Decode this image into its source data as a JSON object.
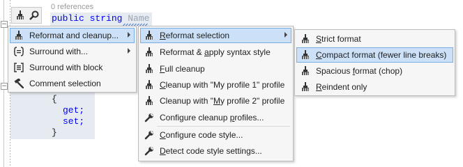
{
  "editor": {
    "references": "0 references",
    "keyword_public": "public",
    "keyword_string": "string",
    "property_name": "Name",
    "open_brace": "{",
    "get": "get;",
    "set": "set;",
    "close_brace": "}"
  },
  "action_button": {
    "icons": [
      "broom-icon",
      "search-icon"
    ]
  },
  "menu1": {
    "items": [
      {
        "label": "Reformat and cleanup...",
        "icon": "broom-icon",
        "submenu": true,
        "selected": true
      },
      {
        "label": "Surround with...",
        "icon": "surround-icon",
        "submenu": true
      },
      {
        "label": "Surround with block",
        "icon": "surround-block-icon",
        "submenu": false
      },
      {
        "label": "Comment selection",
        "icon": "hammer-icon",
        "submenu": false
      }
    ]
  },
  "menu2": {
    "items": [
      {
        "pre": "",
        "acc": "R",
        "post": "eformat selection",
        "icon": "broom-icon",
        "submenu": true,
        "selected": true
      },
      {
        "pre": "Reformat & ",
        "acc": "a",
        "post": "pply syntax style",
        "icon": "broom-icon"
      },
      {
        "pre": "",
        "acc": "F",
        "post": "ull cleanup",
        "icon": "broom-icon"
      },
      {
        "pre": "",
        "acc": "C",
        "post": "leanup with \"My profile 1\" profile",
        "icon": "broom-icon"
      },
      {
        "pre": "Cleanup with \"",
        "acc": "M",
        "post": "y profile 2\" profile",
        "icon": "broom-icon"
      },
      {
        "pre": "Configure cleanup ",
        "acc": "p",
        "post": "rofiles...",
        "icon": "wrench-icon"
      },
      {
        "pre": "",
        "acc": "C",
        "post": "onfigure code style...",
        "icon": "wrench-icon"
      },
      {
        "pre": "",
        "acc": "D",
        "post": "etect code style settings...",
        "icon": "wrench-icon"
      }
    ]
  },
  "menu3": {
    "items": [
      {
        "pre": "",
        "acc": "S",
        "post": "trict format",
        "icon": "broom-icon"
      },
      {
        "pre": "",
        "acc": "C",
        "post": "ompact format (fewer line breaks)",
        "icon": "broom-icon",
        "selected": true
      },
      {
        "pre": "Spacious ",
        "acc": "f",
        "post": "ormat (chop)",
        "icon": "broom-icon"
      },
      {
        "pre": "",
        "acc": "R",
        "post": "eindent only",
        "icon": "broom-icon"
      }
    ]
  }
}
